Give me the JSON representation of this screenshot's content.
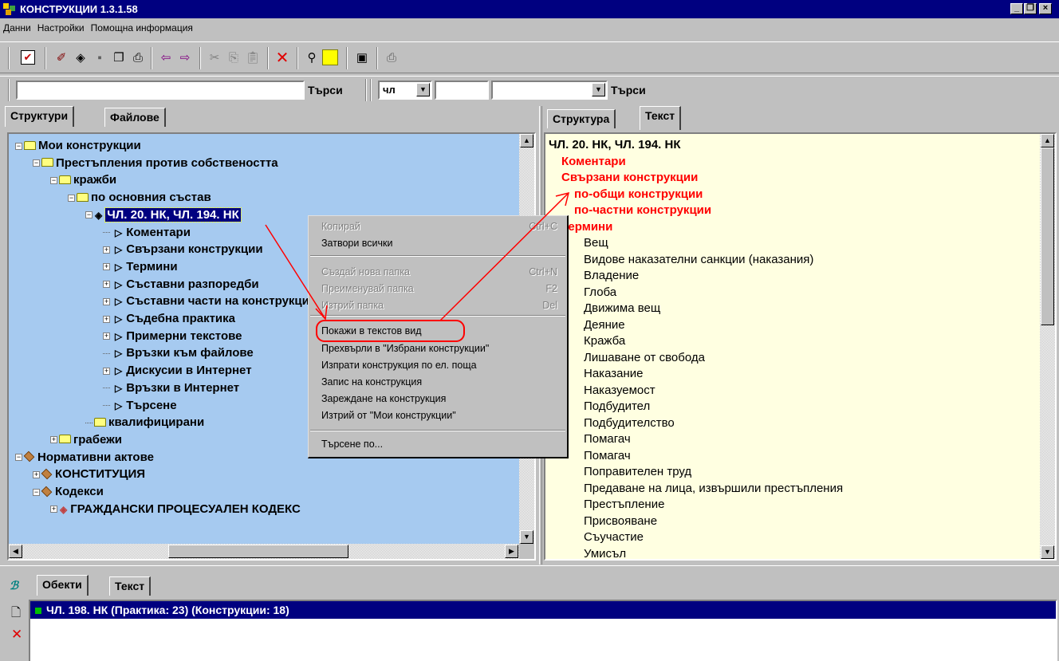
{
  "window": {
    "title": "КОНСТРУКЦИИ 1.3.1.58"
  },
  "menu": [
    "Данни",
    "Настройки",
    "Помощна информация"
  ],
  "search": {
    "button1": "Търси",
    "combo_value": "чл",
    "button2": "Търси"
  },
  "left_tabs": [
    "Структури",
    "Файлове"
  ],
  "right_tabs": [
    "Структура",
    "Текст"
  ],
  "tree": [
    {
      "label": "Мои конструкции",
      "pm": "−"
    },
    {
      "label": "Престъпления против собствеността",
      "pm": "−"
    },
    {
      "label": "кражби",
      "pm": "−"
    },
    {
      "label": "по основния състав",
      "pm": "−"
    },
    {
      "label": "ЧЛ. 20. НК, ЧЛ. 194. НК",
      "pm": "−"
    },
    {
      "label": "Коментари",
      "pm": ""
    },
    {
      "label": "Свързани конструкции",
      "pm": "+"
    },
    {
      "label": "Термини",
      "pm": "+"
    },
    {
      "label": "Съставни разпоредби",
      "pm": "+"
    },
    {
      "label": "Съставни части на конструкцията",
      "pm": "+"
    },
    {
      "label": "Съдебна практика",
      "pm": "+"
    },
    {
      "label": "Примерни текстове",
      "pm": "+"
    },
    {
      "label": "Връзки към файлове",
      "pm": ""
    },
    {
      "label": "Дискусии в Интернет",
      "pm": "+"
    },
    {
      "label": "Връзки в Интернет",
      "pm": ""
    },
    {
      "label": "Търсене",
      "pm": ""
    },
    {
      "label": "квалифицирани",
      "pm": ""
    },
    {
      "label": "грабежи",
      "pm": "+"
    },
    {
      "label": "Нормативни актове",
      "pm": "−"
    },
    {
      "label": "КОНСТИТУЦИЯ",
      "pm": "+"
    },
    {
      "label": "Кодекси",
      "pm": "−"
    },
    {
      "label": "ГРАЖДАНСКИ ПРОЦЕСУАЛЕН КОДЕКС",
      "pm": "+"
    }
  ],
  "context_menu": {
    "items": [
      {
        "label": "Копирай",
        "shortcut": "Ctrl+C",
        "disabled": true
      },
      {
        "label": "Затвори всички",
        "shortcut": "",
        "disabled": false
      },
      {
        "label": "Създай нова папка",
        "shortcut": "Ctrl+N",
        "disabled": true
      },
      {
        "label": "Преименувай папка",
        "shortcut": "F2",
        "disabled": true
      },
      {
        "label": "Изтрий папка",
        "shortcut": "Del",
        "disabled": true
      },
      {
        "label": "Покажи в текстов вид",
        "shortcut": "",
        "disabled": false
      },
      {
        "label": "Прехвърли в \"Избрани конструкции\"",
        "shortcut": "",
        "disabled": false
      },
      {
        "label": "Изпрати конструкция по ел. поща",
        "shortcut": "",
        "disabled": false
      },
      {
        "label": "Запис на конструкция",
        "shortcut": "",
        "disabled": false
      },
      {
        "label": "Зареждане на конструкция",
        "shortcut": "",
        "disabled": false
      },
      {
        "label": "Изтрий от \"Мои конструкции\"",
        "shortcut": "",
        "disabled": false
      },
      {
        "label": "Търсене по...",
        "shortcut": "",
        "disabled": false
      }
    ]
  },
  "text_view": {
    "heading": "ЧЛ. 20. НК, ЧЛ. 194. НК",
    "red": [
      "Коментари",
      "Свързани конструкции",
      "по-общи конструкции",
      "по-частни конструкции",
      "Термини"
    ],
    "terms": [
      "Вещ",
      "Видове наказателни санкции (наказания)",
      "Владение",
      "Глоба",
      "Движима вещ",
      "Деяние",
      "Кражба",
      "Лишаване от свобода",
      "Наказание",
      "Наказуемост",
      "Подбудител",
      "Подбудителство",
      "Помагач",
      "Помагач",
      "Поправителен труд",
      "Предаване на лица, извършили престъпления",
      "Престъпление",
      "Присвояване",
      "Съучастие",
      "Умисъл"
    ]
  },
  "bottom_tabs": [
    "Обекти",
    "Текст"
  ],
  "bottom_list": [
    "ЧЛ. 198. НК  (Практика: 23) (Конструкции: 18)"
  ],
  "colors": {
    "tree_bg": "#a6caf0",
    "text_bg": "#ffffe1",
    "highlight": "#000080",
    "annotation": "#ff0000"
  }
}
